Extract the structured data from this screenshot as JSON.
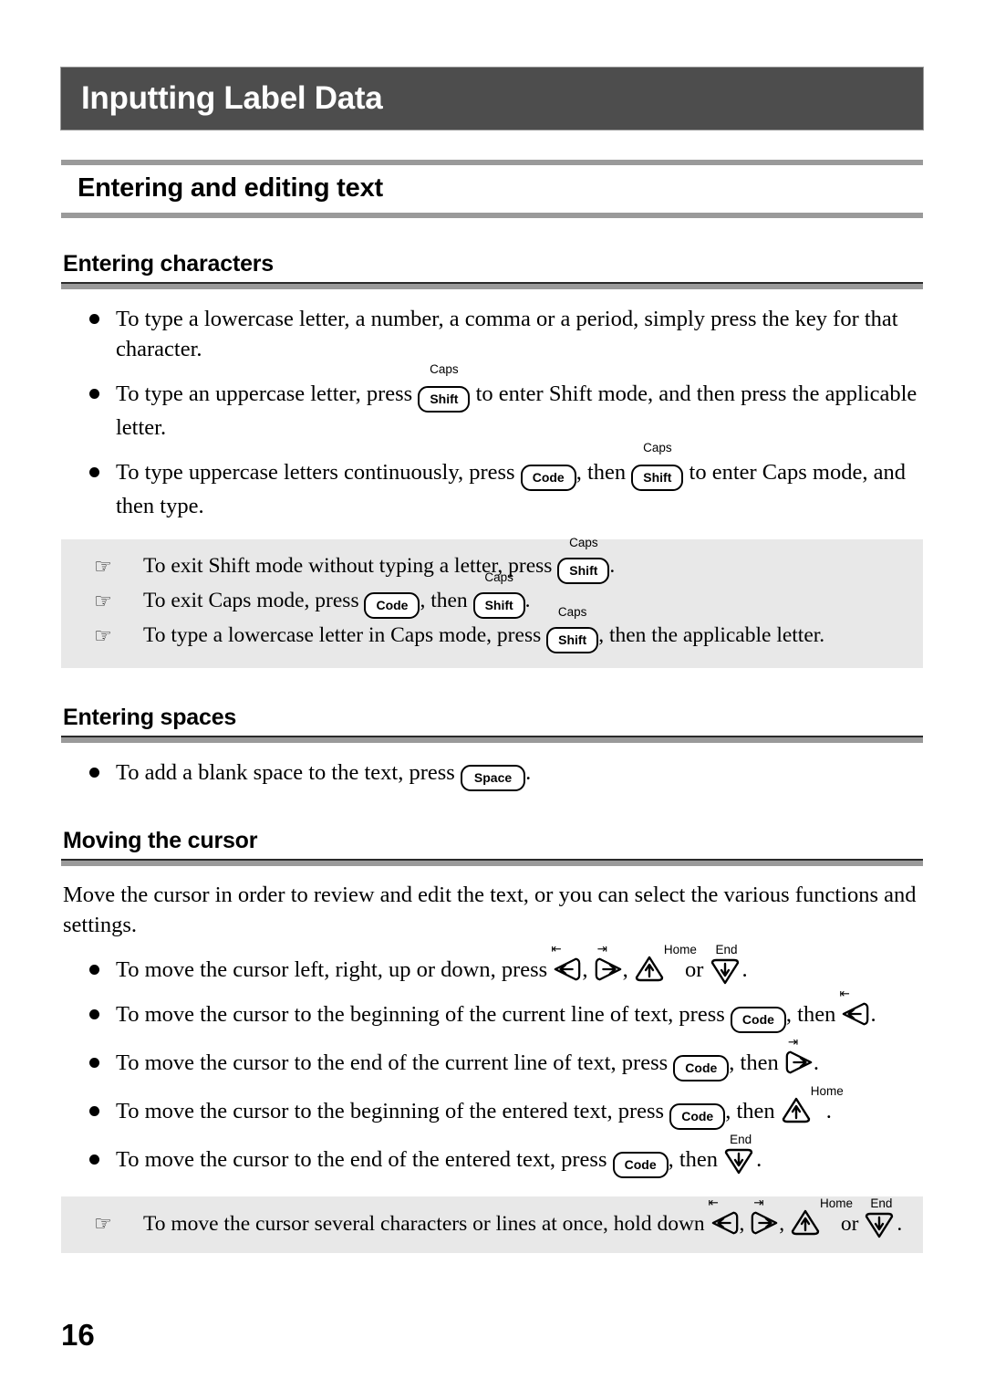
{
  "chapter": {
    "title": "Inputting Label Data"
  },
  "section": {
    "heading": "Entering and editing text"
  },
  "keys": {
    "shift": "Shift",
    "code": "Code",
    "space": "Space",
    "caps_sup": "Caps",
    "home_label": "Home",
    "end_label": "End",
    "left_sup": "⇤",
    "right_sup": "⇥",
    "arrow_left": "←",
    "arrow_right": "→",
    "arrow_up": "↑",
    "arrow_down": "↓"
  },
  "icons": {
    "hand": "☞",
    "bullet": "●"
  },
  "entering_characters": {
    "heading": "Entering characters",
    "bullets": [
      {
        "parts": [
          {
            "t": "text",
            "v": "To type a lowercase letter, a number, a comma or a period, simply press the key for that character."
          }
        ]
      },
      {
        "parts": [
          {
            "t": "text",
            "v": "To type an uppercase letter, press "
          },
          {
            "t": "key",
            "v": "shift",
            "sup": "caps"
          },
          {
            "t": "text",
            "v": " to enter Shift mode, and then press the applicable letter."
          }
        ]
      },
      {
        "parts": [
          {
            "t": "text",
            "v": "To type uppercase letters continuously, press "
          },
          {
            "t": "key",
            "v": "code"
          },
          {
            "t": "text",
            "v": ", then "
          },
          {
            "t": "key",
            "v": "shift",
            "sup": "caps"
          },
          {
            "t": "text",
            "v": " to enter Caps mode, and then type."
          }
        ]
      }
    ],
    "notes": [
      {
        "parts": [
          {
            "t": "text",
            "v": "To exit Shift mode without typing a letter, press "
          },
          {
            "t": "key",
            "v": "shift",
            "sup": "caps"
          },
          {
            "t": "text",
            "v": "."
          }
        ]
      },
      {
        "parts": [
          {
            "t": "text",
            "v": "To exit Caps mode, press "
          },
          {
            "t": "key",
            "v": "code"
          },
          {
            "t": "text",
            "v": ", then "
          },
          {
            "t": "key",
            "v": "shift",
            "sup": "caps"
          },
          {
            "t": "text",
            "v": "."
          }
        ]
      },
      {
        "parts": [
          {
            "t": "text",
            "v": "To type a lowercase letter in Caps mode, press "
          },
          {
            "t": "key",
            "v": "shift",
            "sup": "caps"
          },
          {
            "t": "text",
            "v": ", then the applicable letter."
          }
        ]
      }
    ]
  },
  "entering_spaces": {
    "heading": "Entering spaces",
    "bullets": [
      {
        "parts": [
          {
            "t": "text",
            "v": "To add a blank space to the text, press "
          },
          {
            "t": "key",
            "v": "space"
          },
          {
            "t": "text",
            "v": "."
          }
        ]
      }
    ]
  },
  "moving_the_cursor": {
    "heading": "Moving the cursor",
    "intro": "Move the cursor in order to review and edit the text, or you can select the various functions and settings.",
    "bullets": [
      {
        "parts": [
          {
            "t": "text",
            "v": "To move the cursor left, right, up or down, press "
          },
          {
            "t": "akey",
            "v": "left"
          },
          {
            "t": "text",
            "v": ", "
          },
          {
            "t": "akey",
            "v": "right"
          },
          {
            "t": "text",
            "v": ", "
          },
          {
            "t": "akey",
            "v": "up"
          },
          {
            "t": "text",
            "v": " or "
          },
          {
            "t": "akey",
            "v": "down"
          },
          {
            "t": "text",
            "v": "."
          }
        ]
      },
      {
        "parts": [
          {
            "t": "text",
            "v": "To move the cursor to the beginning of the current line of text, press "
          },
          {
            "t": "key",
            "v": "code"
          },
          {
            "t": "text",
            "v": ", then "
          },
          {
            "t": "akey",
            "v": "left"
          },
          {
            "t": "text",
            "v": "."
          }
        ]
      },
      {
        "parts": [
          {
            "t": "text",
            "v": "To move the cursor to the end of the current line of text, press "
          },
          {
            "t": "key",
            "v": "code"
          },
          {
            "t": "text",
            "v": ", then "
          },
          {
            "t": "akey",
            "v": "right"
          },
          {
            "t": "text",
            "v": "."
          }
        ]
      },
      {
        "parts": [
          {
            "t": "text",
            "v": "To move the cursor to the beginning of the entered text, press "
          },
          {
            "t": "key",
            "v": "code"
          },
          {
            "t": "text",
            "v": ", then "
          },
          {
            "t": "akey",
            "v": "up"
          },
          {
            "t": "text",
            "v": "."
          }
        ]
      },
      {
        "parts": [
          {
            "t": "text",
            "v": "To move the cursor to the end of the entered text, press "
          },
          {
            "t": "key",
            "v": "code"
          },
          {
            "t": "text",
            "v": ", then "
          },
          {
            "t": "akey",
            "v": "down"
          },
          {
            "t": "text",
            "v": "."
          }
        ]
      }
    ],
    "notes": [
      {
        "parts": [
          {
            "t": "text",
            "v": "To move the cursor several characters or lines at once, hold down "
          },
          {
            "t": "akey",
            "v": "left"
          },
          {
            "t": "text",
            "v": ", "
          },
          {
            "t": "akey",
            "v": "right"
          },
          {
            "t": "text",
            "v": ", "
          },
          {
            "t": "akey",
            "v": "up"
          },
          {
            "t": "text",
            "v": " or "
          },
          {
            "t": "akey",
            "v": "down"
          },
          {
            "t": "text",
            "v": "."
          }
        ]
      }
    ]
  },
  "footer": {
    "page_number": "16"
  },
  "colors": {
    "chapter_bar": "#4d4d4d",
    "rule_gray": "#9a9a9a",
    "note_background": "#e8e8e8",
    "text": "#000000"
  }
}
